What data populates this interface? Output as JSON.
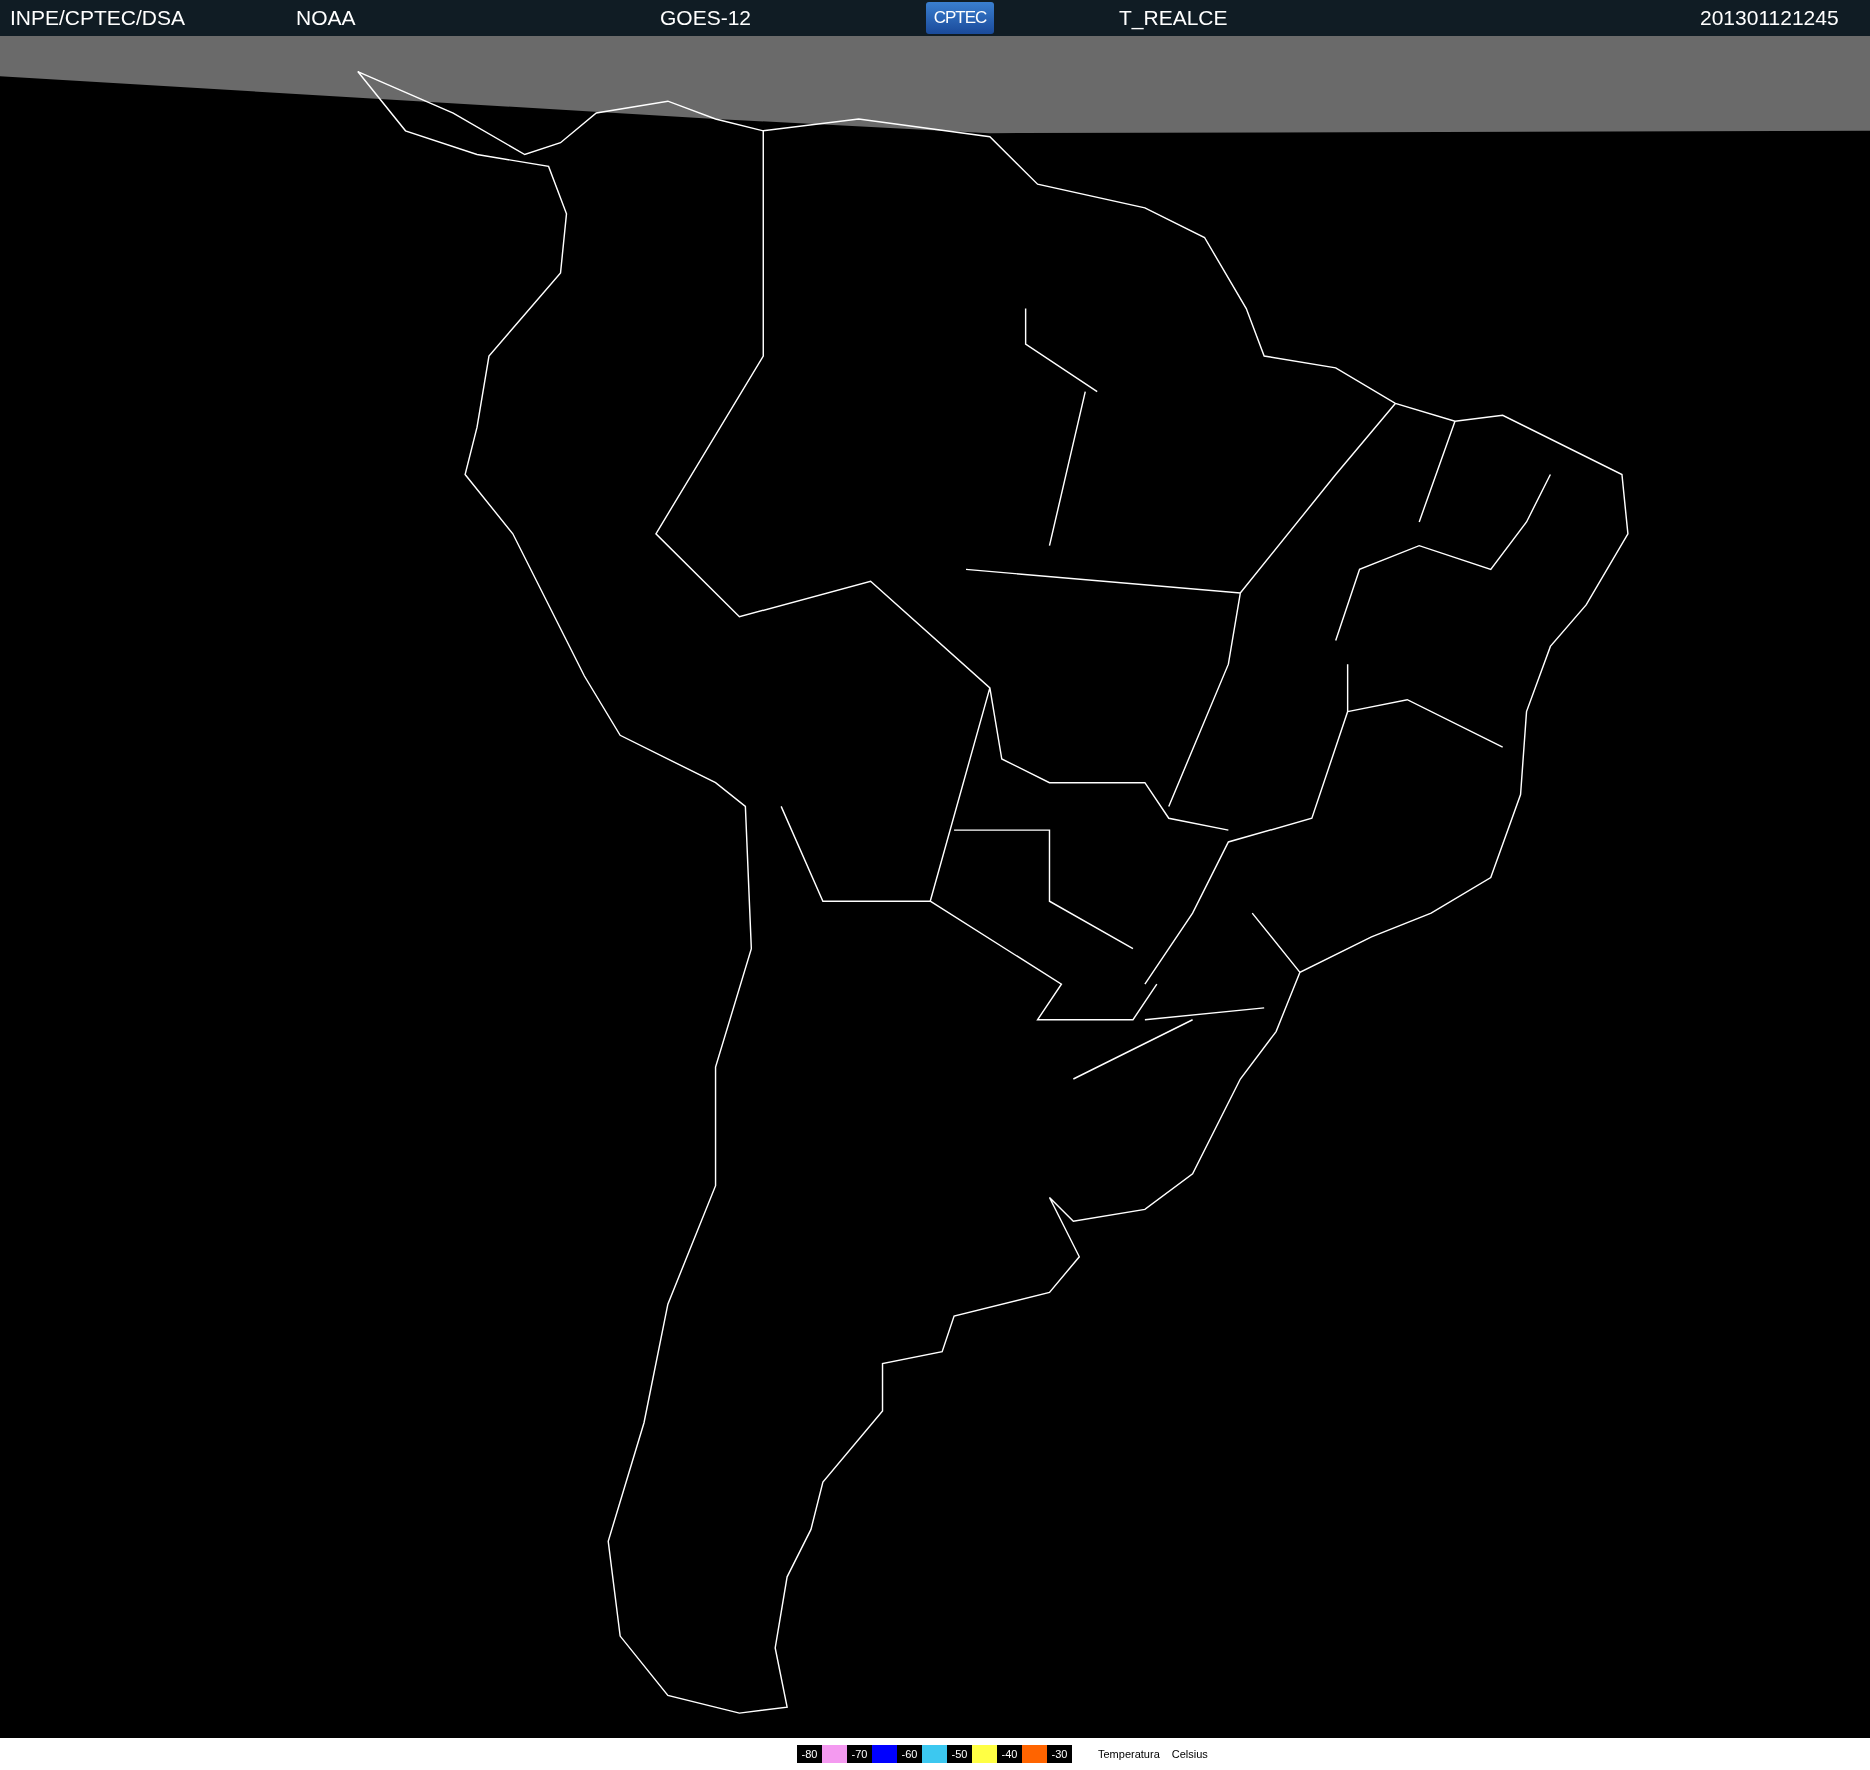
{
  "header": {
    "items": [
      {
        "kind": "text",
        "text": "INPE/CPTEC/DSA"
      },
      {
        "kind": "text",
        "text": "NOAA"
      },
      {
        "kind": "text",
        "text": "GOES-12"
      },
      {
        "kind": "logo",
        "text": "CPTEC"
      },
      {
        "kind": "text",
        "text": "T_REALCE"
      },
      {
        "kind": "text",
        "text": "201301121245"
      }
    ]
  },
  "legend": {
    "items": [
      {
        "kind": "label",
        "text": "-80"
      },
      {
        "kind": "swatch",
        "color": "#f49af0"
      },
      {
        "kind": "label",
        "text": "-70"
      },
      {
        "kind": "swatch",
        "color": "#0000ff"
      },
      {
        "kind": "label",
        "text": "-60"
      },
      {
        "kind": "swatch",
        "color": "#3cc8f0"
      },
      {
        "kind": "label",
        "text": "-50"
      },
      {
        "kind": "swatch",
        "color": "#ffff44"
      },
      {
        "kind": "label",
        "text": "-40"
      },
      {
        "kind": "swatch",
        "color": "#ff6400"
      },
      {
        "kind": "label",
        "text": "-30"
      }
    ],
    "title": "Temperatura",
    "unit": "Celsius"
  }
}
